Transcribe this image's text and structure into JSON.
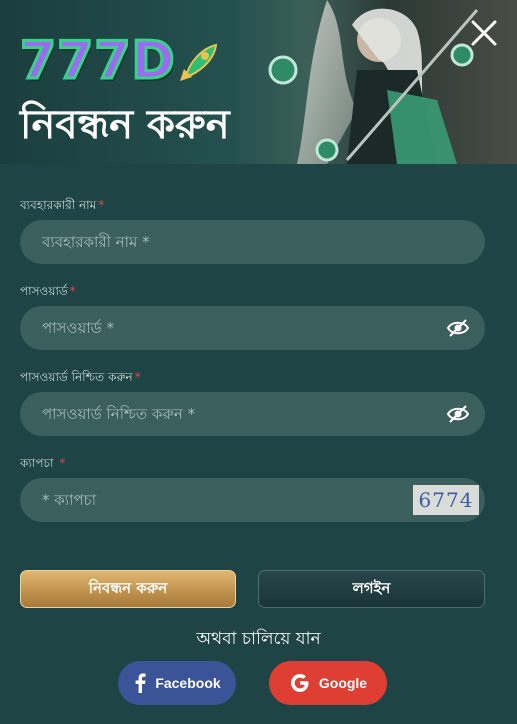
{
  "header": {
    "logo_text": "777D",
    "title": "নিবন্ধন করুন"
  },
  "form": {
    "username": {
      "label": "ব্যবহারকারী নাম",
      "required_mark": "*",
      "placeholder": "ব্যবহারকারী নাম *",
      "value": ""
    },
    "password": {
      "label": "পাসওয়ার্ড",
      "required_mark": "*",
      "placeholder": "পাসওয়ার্ড *",
      "value": ""
    },
    "confirm_password": {
      "label": "পাসওয়ার্ড নিশ্চিত করুন",
      "required_mark": "*",
      "placeholder": "পাসওয়ার্ড নিশ্চিত করুন *",
      "value": ""
    },
    "captcha": {
      "label": "ক্যাপচা",
      "required_mark": "*",
      "placeholder": "* ক্যাপচা",
      "value": "",
      "code": "6774"
    }
  },
  "actions": {
    "register_label": "নিবন্ধন করুন",
    "login_label": "লগইন"
  },
  "social": {
    "divider": "অথবা চালিয়ে যান",
    "facebook_label": "Facebook",
    "google_label": "Google"
  },
  "colors": {
    "background": "#1e4446",
    "input_bg": "#3b5f5d",
    "accent_gold": "#c1934f",
    "facebook": "#3b5497",
    "google": "#df3f33",
    "required": "#e0474c"
  },
  "icons": [
    "close-icon",
    "eye-off-icon",
    "rocket-icon",
    "facebook-icon",
    "google-icon"
  ]
}
